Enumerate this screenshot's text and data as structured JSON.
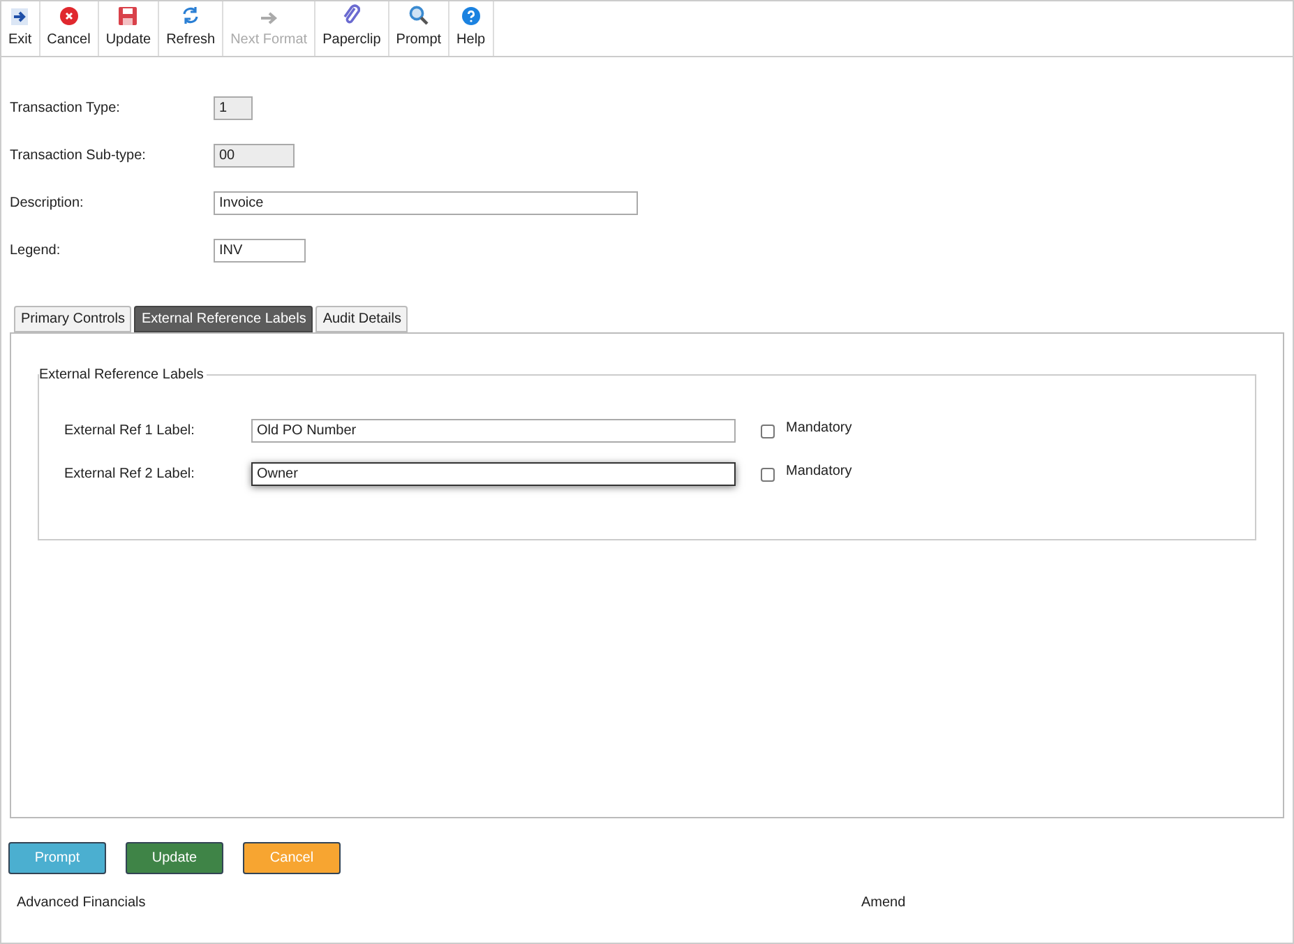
{
  "toolbar": [
    {
      "kind": "exit",
      "label": "Exit",
      "disabled": false
    },
    {
      "kind": "cancel",
      "label": "Cancel",
      "disabled": false
    },
    {
      "kind": "update",
      "label": "Update",
      "disabled": false
    },
    {
      "kind": "refresh",
      "label": "Refresh",
      "disabled": false
    },
    {
      "kind": "next",
      "label": "Next Format",
      "disabled": true
    },
    {
      "kind": "paperclip",
      "label": "Paperclip",
      "disabled": false
    },
    {
      "kind": "prompt",
      "label": "Prompt",
      "disabled": false
    },
    {
      "kind": "help",
      "label": "Help",
      "disabled": false
    }
  ],
  "fields": [
    {
      "label": "Transaction Type:",
      "value": "1",
      "readonly": true
    },
    {
      "label": "Transaction Sub-type:",
      "value": "00",
      "readonly": true
    },
    {
      "label": "Description:",
      "value": "Invoice",
      "readonly": false
    },
    {
      "label": "Legend:",
      "value": "INV",
      "readonly": false
    }
  ],
  "tabs": [
    {
      "label": "Primary Controls",
      "selected": false
    },
    {
      "label": "External Reference Labels",
      "selected": true
    },
    {
      "label": "Audit Details",
      "selected": false
    }
  ],
  "group": {
    "title": "External Reference Labels",
    "rows": [
      {
        "label": "External Ref 1 Label:",
        "value": "Old PO Number",
        "focused": false,
        "checkbox": {
          "label": "Mandatory",
          "checked": false
        }
      },
      {
        "label": "External Ref 2 Label:",
        "value": "Owner",
        "focused": true,
        "checkbox": {
          "label": "Mandatory",
          "checked": false
        }
      }
    ]
  },
  "buttons": [
    {
      "kind": "prompt",
      "label": "Prompt"
    },
    {
      "kind": "update",
      "label": "Update"
    },
    {
      "kind": "cancel",
      "label": "Cancel"
    }
  ],
  "status_bar": {
    "module": "Advanced Financials",
    "mode": "Amend"
  }
}
